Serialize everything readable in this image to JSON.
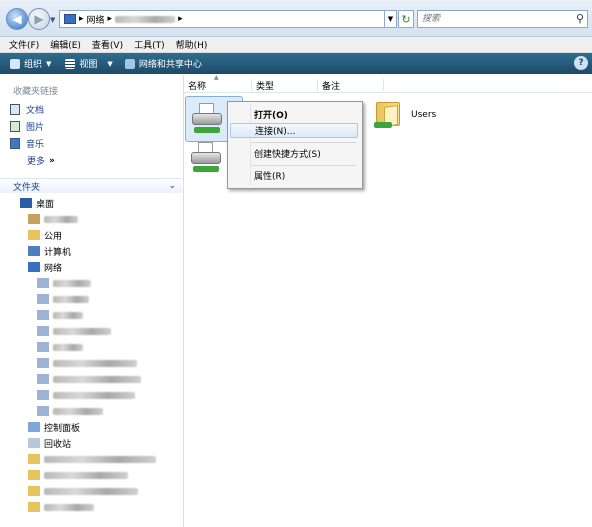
{
  "address": {
    "crumb_network": "网络",
    "search_placeholder": "搜索"
  },
  "menu": [
    "文件(F)",
    "编辑(E)",
    "查看(V)",
    "工具(T)",
    "帮助(H)"
  ],
  "toolbar": {
    "organize": "组织",
    "view": "视图",
    "network_center": "网络和共享中心"
  },
  "nav": {
    "favorites_heading": "收藏夹链接",
    "links": [
      "文档",
      "图片",
      "音乐"
    ],
    "more": "更多",
    "more_arrows": "»",
    "folders_heading": "文件夹",
    "tree": {
      "desktop": "桌面",
      "public": "公用",
      "computer": "计算机",
      "network": "网络",
      "control_panel": "控制面板",
      "recycle_bin": "回收站"
    }
  },
  "columns": [
    "名称",
    "类型",
    "备注"
  ],
  "items": {
    "users_folder": "Users"
  },
  "context_menu": {
    "open": "打开(O)",
    "connect": "连接(N)...",
    "create_shortcut": "创建快捷方式(S)",
    "properties": "属性(R)"
  },
  "colors": {
    "toolbar": "#1d4a68",
    "link": "#1e3f8c",
    "highlight_border": "#a8c8ea"
  }
}
